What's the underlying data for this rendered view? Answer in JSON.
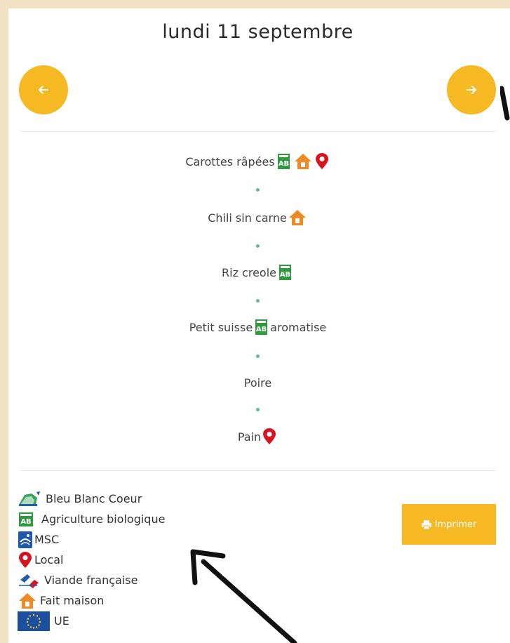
{
  "header": {
    "date": "lundi 11 septembre"
  },
  "menu": {
    "items": [
      {
        "parts": [
          "Carottes râpées"
        ],
        "icons": [
          "ab-icon",
          "house-icon",
          "pin-icon"
        ]
      },
      {
        "parts": [
          "Chili sin carne"
        ],
        "icons": [
          "house-icon"
        ]
      },
      {
        "parts": [
          "Riz creole"
        ],
        "icons": [
          "ab-icon"
        ]
      },
      {
        "parts": [
          "Petit suisse",
          "aromatise"
        ],
        "icons": [
          "ab-icon"
        ]
      },
      {
        "parts": [
          "Poire"
        ],
        "icons": []
      },
      {
        "parts": [
          "Pain"
        ],
        "icons": [
          "pin-icon"
        ]
      }
    ]
  },
  "legend": {
    "items": [
      {
        "label": "Bleu Blanc Coeur",
        "icon": "bleu-blanc-coeur-icon"
      },
      {
        "label": "Agriculture biologique",
        "icon": "ab-icon"
      },
      {
        "label": "MSC",
        "icon": "msc-icon"
      },
      {
        "label": "Local",
        "icon": "pin-icon"
      },
      {
        "label": "Viande française",
        "icon": "viande-francaise-icon"
      },
      {
        "label": "Fait maison",
        "icon": "house-icon"
      },
      {
        "label": "UE",
        "icon": "eu-flag-icon"
      }
    ]
  },
  "actions": {
    "print_label": "Imprimer"
  },
  "colors": {
    "accent": "#f7b923",
    "page_background": "#f1e2c3",
    "separator_dot": "#5fb89b",
    "organic_green": "#2e9a3e",
    "house_orange": "#f08a24",
    "pin_red": "#d6141f"
  }
}
